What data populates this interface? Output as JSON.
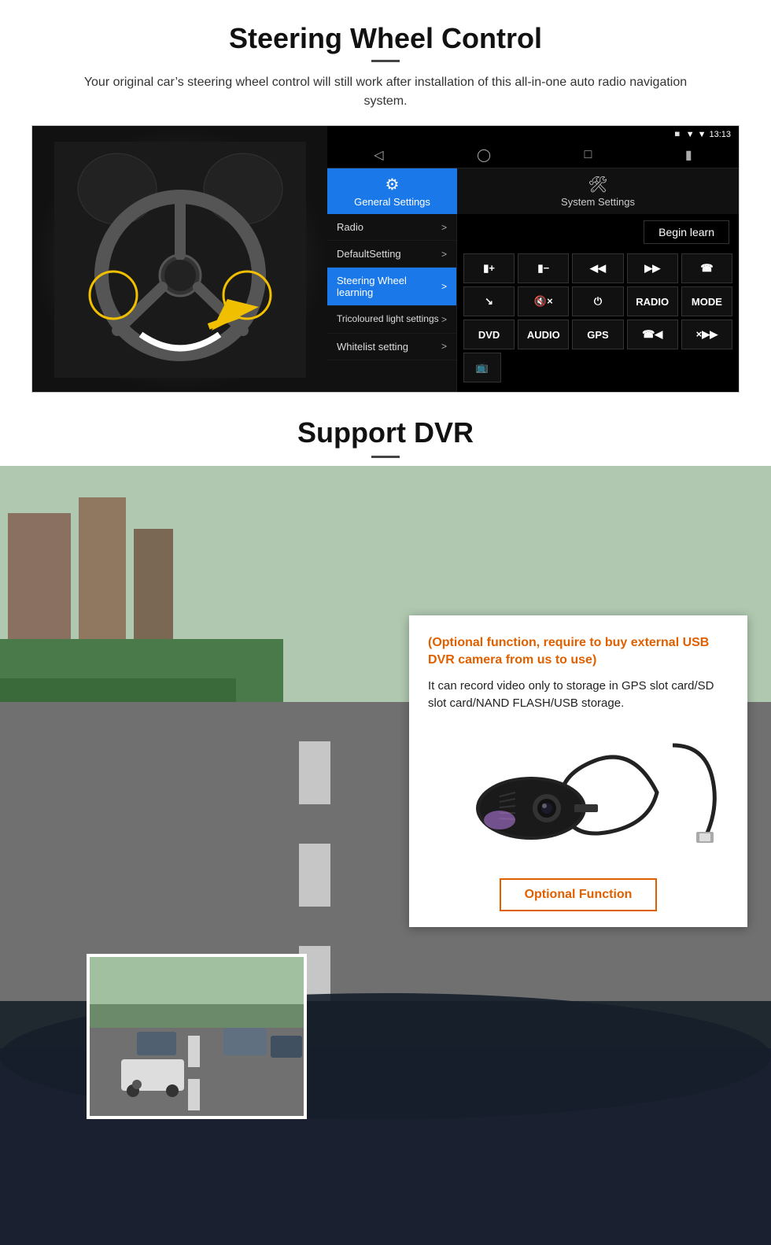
{
  "steering": {
    "title": "Steering Wheel Control",
    "subtitle": "Your original car’s steering wheel control will still work after installation of this all-in-one auto radio navigation system.",
    "android": {
      "statusbar": {
        "time": "13:13",
        "signal_icon": "▾",
        "wifi_icon": "▾",
        "location_icon": "✥"
      },
      "nav_icons": [
        "◁",
        "○",
        "□",
        "◼"
      ],
      "tabs": [
        {
          "label": "General Settings",
          "icon": "⚙",
          "active": true
        },
        {
          "label": "System Settings",
          "icon": "🛠",
          "active": false
        }
      ],
      "menu_items": [
        {
          "label": "Radio",
          "active": false
        },
        {
          "label": "DefaultSetting",
          "active": false
        },
        {
          "label": "Steering Wheel learning",
          "active": true
        },
        {
          "label": "Tricoloured light settings",
          "active": false
        },
        {
          "label": "Whitelist setting",
          "active": false
        }
      ],
      "begin_learn_label": "Begin learn",
      "button_rows": [
        [
          "⏮+",
          "⏮−",
          "⏮⏮",
          "⏭⏭",
          "☎"
        ],
        [
          "↘",
          "🔇×",
          "⏻",
          "RADIO",
          "MODE"
        ],
        [
          "DVD",
          "AUDIO",
          "GPS",
          "☎⏮",
          "×⏭⏭"
        ]
      ]
    }
  },
  "dvr": {
    "title": "Support DVR",
    "optional_text": "(Optional function, require to buy external USB DVR camera from us to use)",
    "description": "It can record video only to storage in GPS slot card/SD slot card/NAND FLASH/USB storage.",
    "optional_btn_label": "Optional Function"
  }
}
